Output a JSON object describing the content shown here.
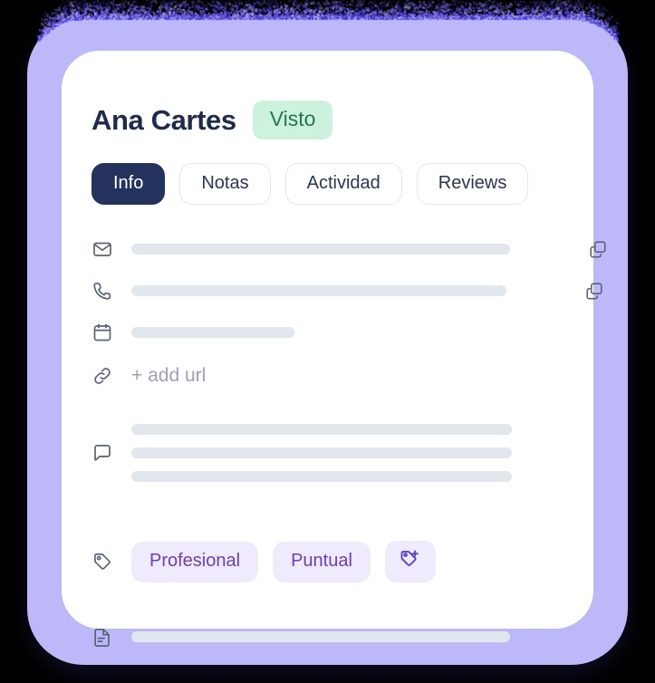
{
  "card": {
    "person_name": "Ana Cartes",
    "status_badge": "Visto",
    "tabs": [
      {
        "label": "Info",
        "active": true
      },
      {
        "label": "Notas",
        "active": false
      },
      {
        "label": "Actividad",
        "active": false
      },
      {
        "label": "Reviews",
        "active": false
      }
    ],
    "rows": {
      "email": {
        "icon": "envelope-icon",
        "value_placeholder": "",
        "copy_icon": "copy-icon"
      },
      "phone": {
        "icon": "phone-icon",
        "value_placeholder": "",
        "copy_icon": "copy-icon"
      },
      "date": {
        "icon": "calendar-icon",
        "value_placeholder": ""
      },
      "url": {
        "icon": "link-icon",
        "add_label": "+ add url"
      },
      "notes": {
        "icon": "chat-bubble-icon"
      },
      "tags": {
        "icon": "tag-icon",
        "chips": [
          "Profesional",
          "Puntual"
        ],
        "add_icon": "tag-plus-icon"
      },
      "document": {
        "icon": "document-icon"
      }
    }
  },
  "colors": {
    "frame": "#BDB9F8",
    "card": "#FFFFFF",
    "name_text": "#1E2A4E",
    "badge_bg": "#CCF2DE",
    "badge_text": "#1F7A52",
    "tab_active_bg": "#23335E",
    "tab_border": "#E4E7EC",
    "skeleton": "#E2E7EE",
    "icon": "#5A6478",
    "chip_bg": "#EFEBFC",
    "chip_text": "#6B3FC4",
    "chip_add_icon": "#5B3FD4",
    "muted_text": "#9AA3B5"
  }
}
